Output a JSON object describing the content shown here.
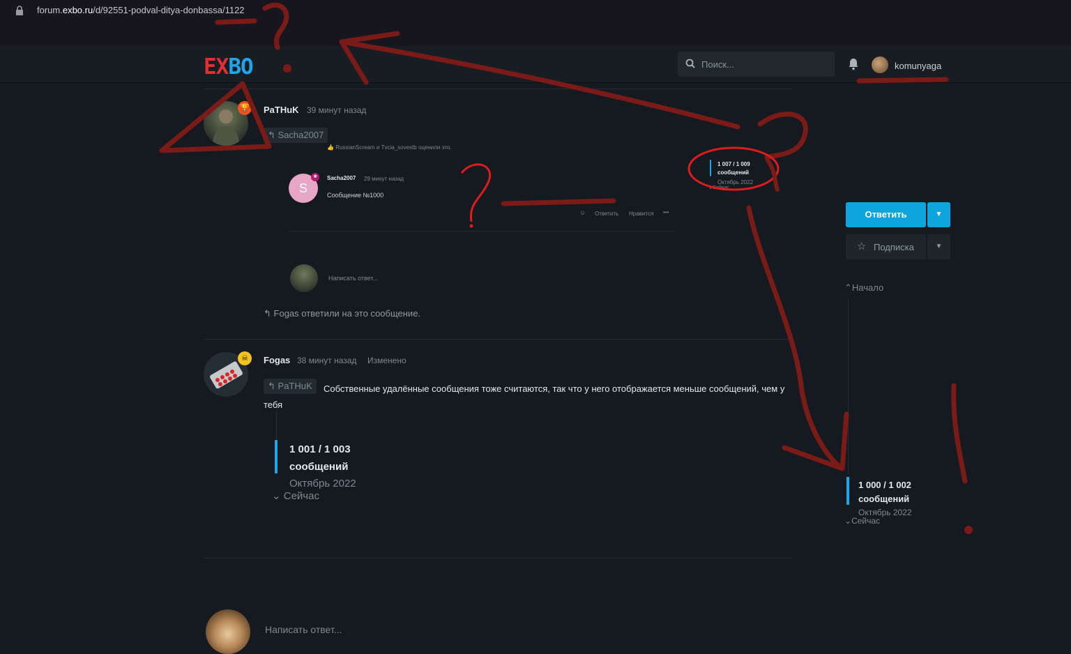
{
  "browser": {
    "url_prefix": "forum.",
    "url_domain": "exbo.ru",
    "url_path": "/d/92551-podval-ditya-donbassa/1122"
  },
  "header": {
    "logo_part1": "EX",
    "logo_part2": "BO",
    "search_placeholder": "Поиск...",
    "username": "komunyaga"
  },
  "post1": {
    "author": "PaTHuK",
    "time": "39 минут назад",
    "reply_to": "Sacha2007",
    "likes_text": "RussianScream и Tvcia_sovestb оценили это.",
    "nested": {
      "initial": "S",
      "author": "Sacha2007",
      "time": "29 минут назад",
      "text": "Сообщение №1000",
      "actions": {
        "reply": "Ответить",
        "like": "Нравится",
        "more": "•••"
      },
      "mini_scrub": {
        "count": "1 007 / 1 009",
        "label": "сообщений",
        "date": "Октябрь 2022",
        "now": "Сейчас"
      },
      "write_reply": "Написать ответ..."
    },
    "replied_text": "Fogas ответили на это сообщение."
  },
  "post2": {
    "author": "Fogas",
    "time": "38 минут назад",
    "edited": "Изменено",
    "reply_to": "PaTHuK",
    "text": "Собственные удалённые сообщения тоже считаются, так что у него отображается меньше сообщений, чем у тебя",
    "scrub": {
      "count": "1 001 / 1 003",
      "label": "сообщений",
      "date": "Октябрь 2022",
      "now": "Сейчас"
    }
  },
  "sidebar": {
    "reply_button": "Ответить",
    "subscribe_button": "Подписка",
    "start": "Начало",
    "scrub": {
      "count": "1 000 / 1 002",
      "label": "сообщений",
      "date": "Октябрь 2022",
      "now": "Сейчас"
    }
  },
  "composer": {
    "placeholder": "Написать ответ..."
  },
  "colors": {
    "accent": "#0ea4dd",
    "background": "#141a1f",
    "annotation": "#7a1b18"
  }
}
